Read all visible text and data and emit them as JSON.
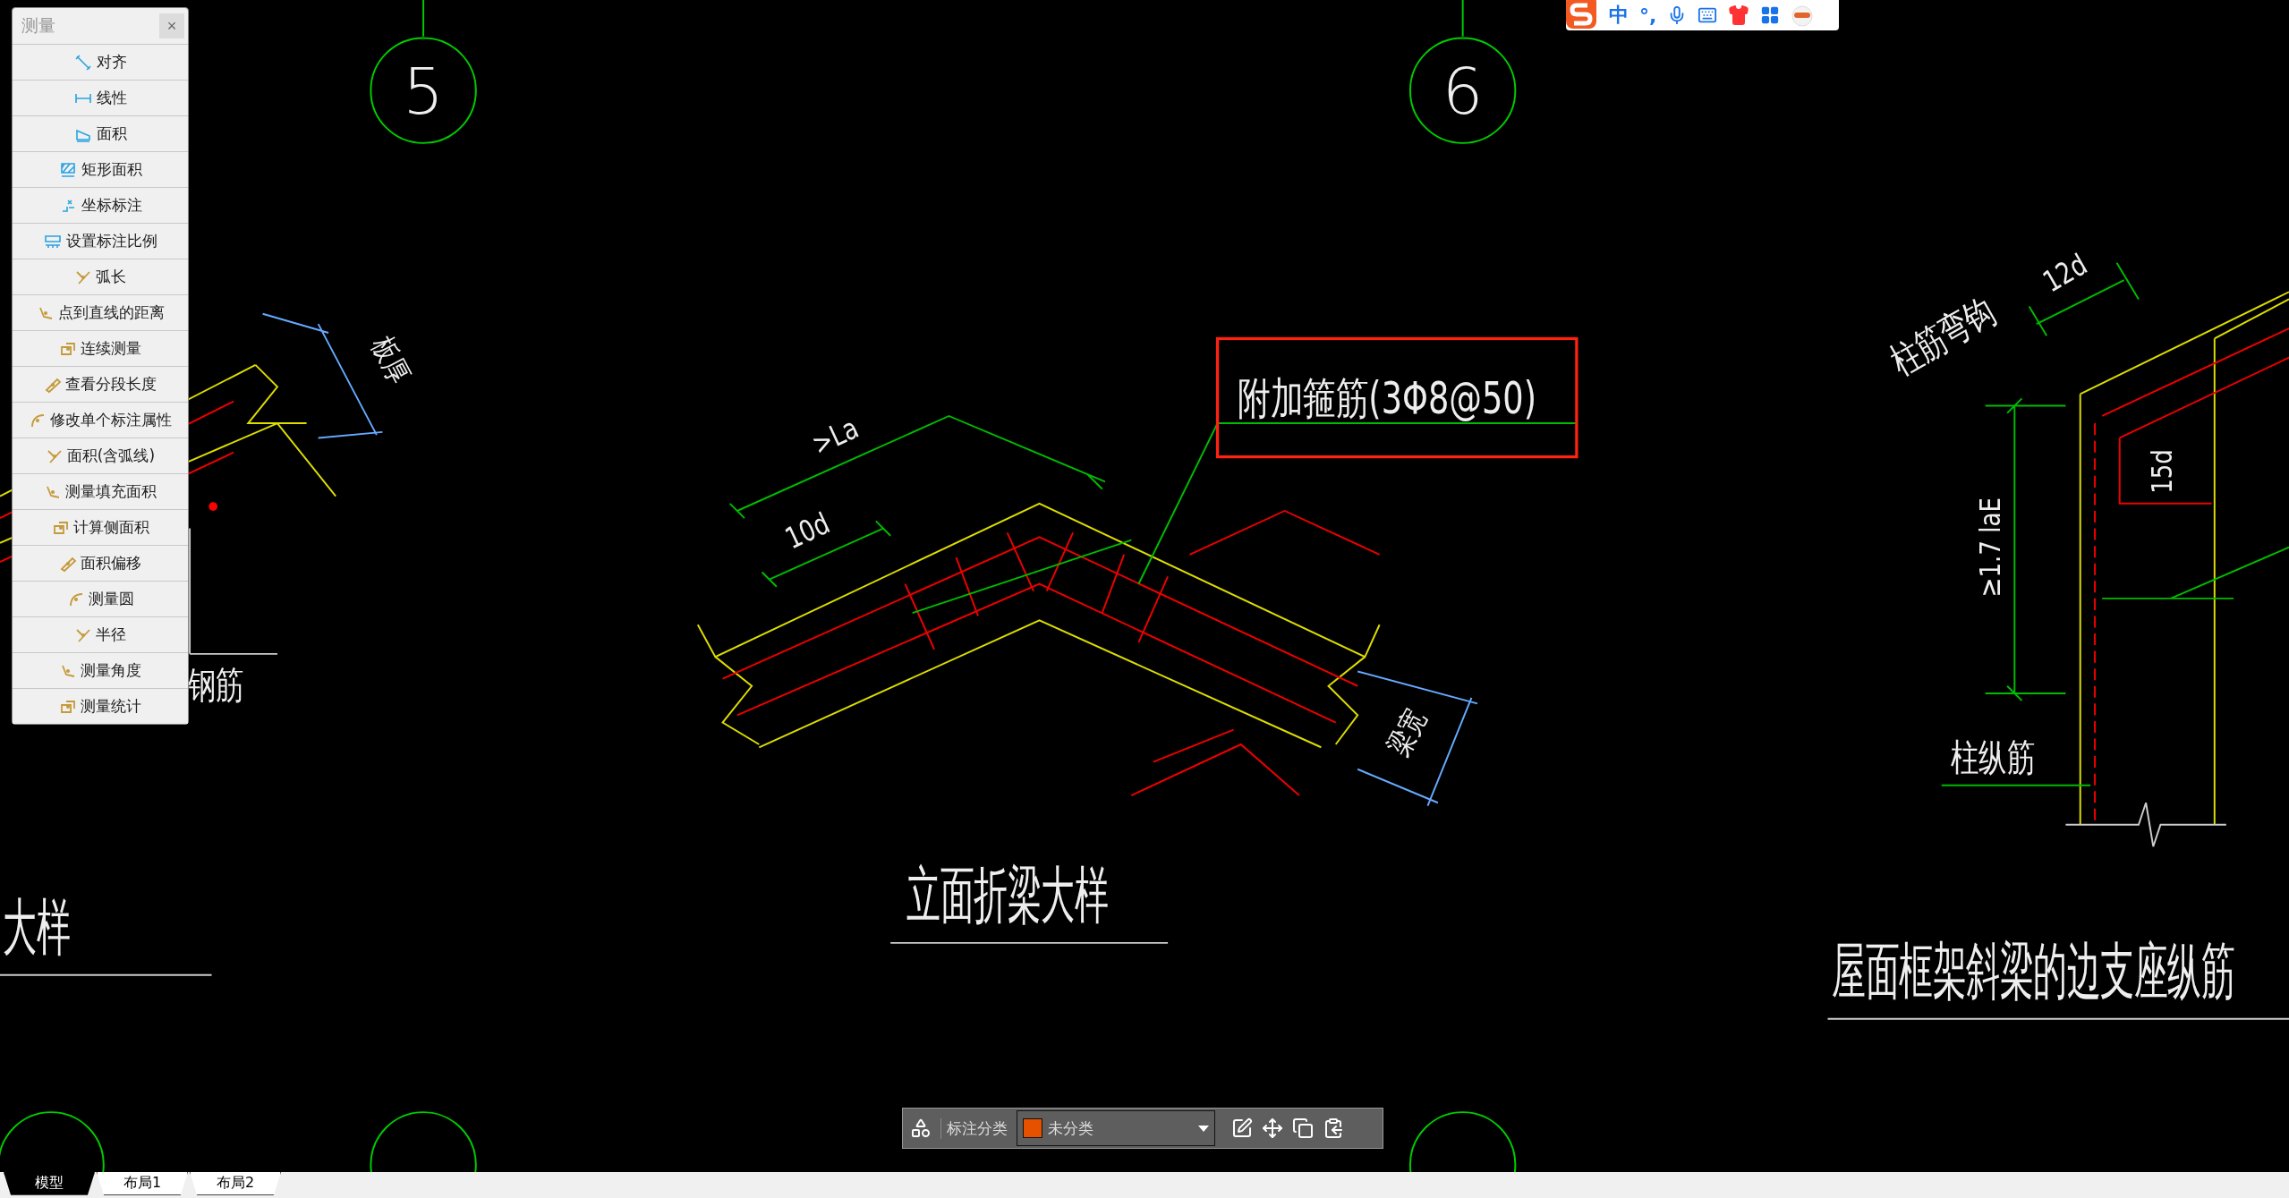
{
  "panel": {
    "title": "测量",
    "close": "×",
    "items": [
      {
        "label": "对齐",
        "kind": "dimension"
      },
      {
        "label": "线性",
        "kind": "dimension"
      },
      {
        "label": "面积",
        "kind": "dimension"
      },
      {
        "label": "矩形面积",
        "kind": "dimension"
      },
      {
        "label": "坐标标注",
        "kind": "dimension"
      },
      {
        "label": "设置标注比例",
        "kind": "dimension"
      },
      {
        "label": "弧长",
        "kind": "tool"
      },
      {
        "label": "点到直线的距离",
        "kind": "tool"
      },
      {
        "label": "连续测量",
        "kind": "tool"
      },
      {
        "label": "查看分段长度",
        "kind": "tool"
      },
      {
        "label": "修改单个标注属性",
        "kind": "tool"
      },
      {
        "label": "面积(含弧线)",
        "kind": "tool"
      },
      {
        "label": "测量填充面积",
        "kind": "tool"
      },
      {
        "label": "计算侧面积",
        "kind": "tool"
      },
      {
        "label": "面积偏移",
        "kind": "tool"
      },
      {
        "label": "测量圆",
        "kind": "tool"
      },
      {
        "label": "半径",
        "kind": "tool"
      },
      {
        "label": "测量角度",
        "kind": "tool"
      },
      {
        "label": "测量统计",
        "kind": "tool"
      }
    ]
  },
  "ime_bar": {
    "items": [
      {
        "kind": "logo"
      },
      {
        "kind": "text",
        "label": "中"
      },
      {
        "kind": "text",
        "label": "°,"
      },
      {
        "kind": "mic"
      },
      {
        "kind": "keyboard"
      },
      {
        "kind": "shirt"
      },
      {
        "kind": "apps"
      },
      {
        "kind": "mascot"
      }
    ]
  },
  "canvas": {
    "grid_bubbles": [
      {
        "label": "5"
      },
      {
        "label": "6"
      }
    ],
    "labels": [
      {
        "text": "附加箍筋(3Φ8@50)",
        "kind": "callout"
      },
      {
        "text": ">La",
        "kind": "dim"
      },
      {
        "text": "10d",
        "kind": "dim"
      },
      {
        "text": "梁宽",
        "kind": "dim"
      },
      {
        "text": "板厚",
        "kind": "dim"
      },
      {
        "text": "钢筋",
        "kind": "note"
      },
      {
        "text": "立面折梁大样",
        "kind": "title"
      },
      {
        "text": "大样",
        "kind": "title"
      },
      {
        "text": "柱筋弯钩",
        "kind": "note"
      },
      {
        "text": "12d",
        "kind": "dim"
      },
      {
        "text": "15d",
        "kind": "dim"
      },
      {
        "text": "≥1.7 laE",
        "kind": "dim"
      },
      {
        "text": "柱纵筋",
        "kind": "note"
      },
      {
        "text": "屋面框架斜梁的边支座纵筋",
        "kind": "title"
      }
    ]
  },
  "annotation_toolbar": {
    "label": "标注分类",
    "category": {
      "value": "未分类",
      "color": "#e65100"
    }
  },
  "tabs": [
    {
      "label": "模型",
      "selected": true
    },
    {
      "label": "布局1",
      "selected": false
    },
    {
      "label": "布局2",
      "selected": false
    }
  ]
}
